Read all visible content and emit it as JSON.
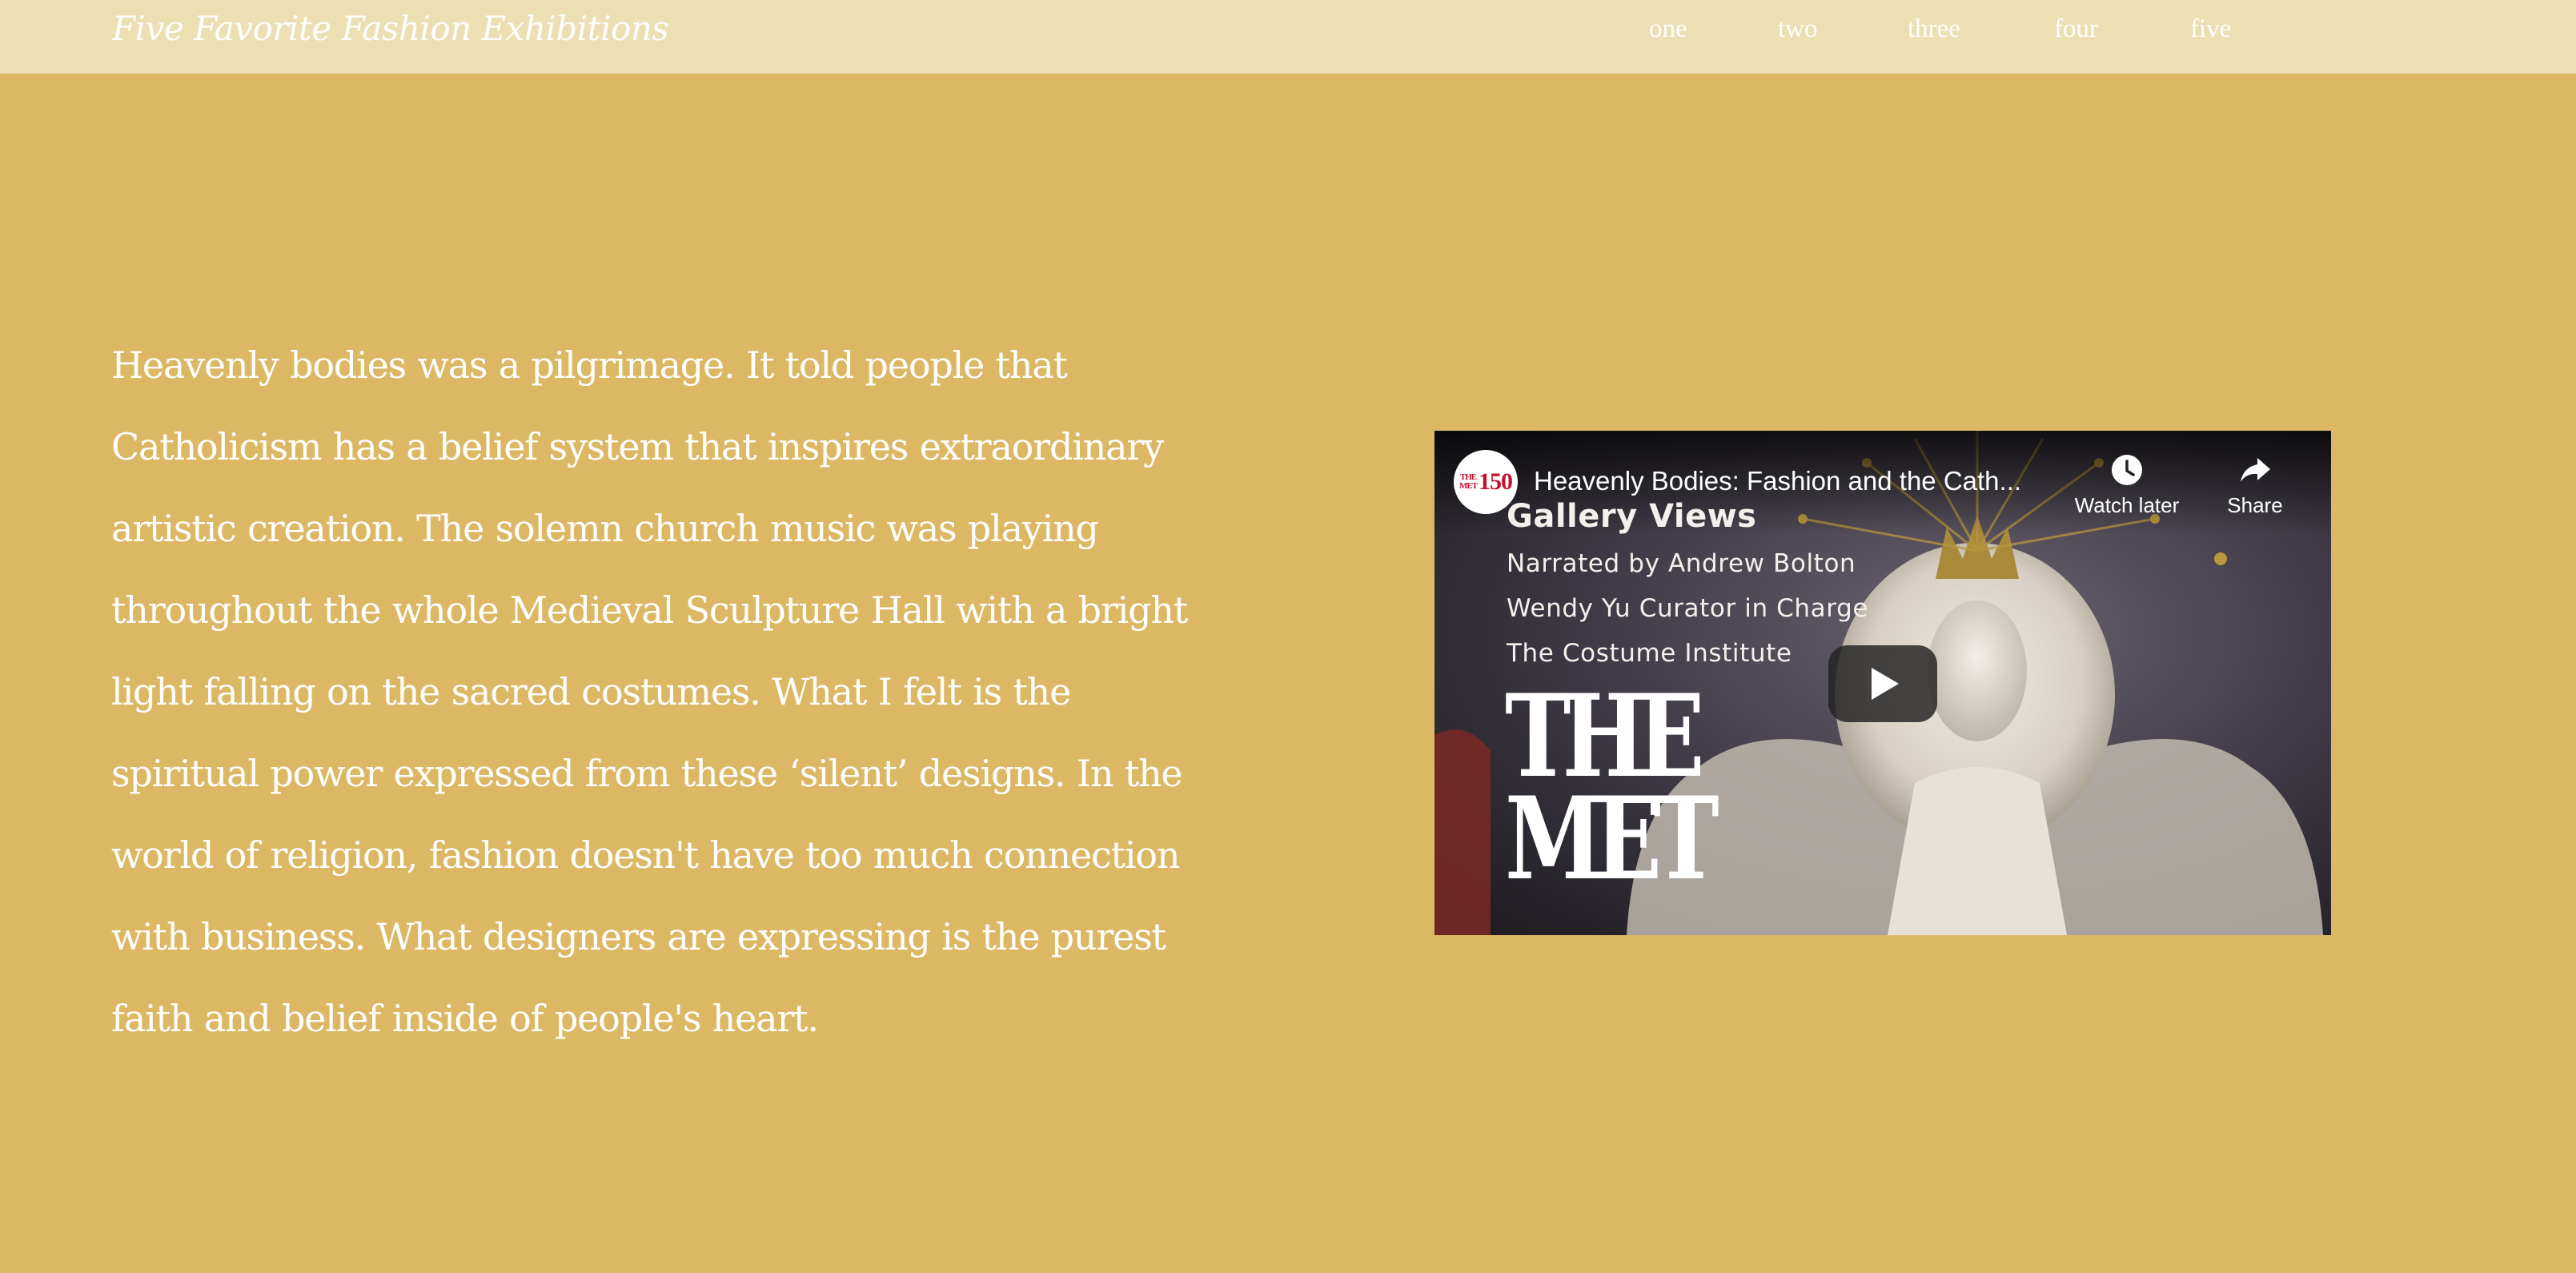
{
  "header": {
    "site_title": "Five Favorite Fashion Exhibitions",
    "nav": [
      {
        "label": "one"
      },
      {
        "label": "two"
      },
      {
        "label": "three"
      },
      {
        "label": "four"
      },
      {
        "label": "five"
      }
    ]
  },
  "main": {
    "paragraph": "Heavenly bodies was a pilgrimage. It told people that Catholicism has a belief system that inspires extraordinary artistic creation. The solemn church music was playing throughout the whole Medieval Sculpture Hall with a bright light falling on the sacred costumes. What I felt is the spiritual power expressed from these ‘silent’ designs. In the world of religion, fashion doesn't have too much connection with business. What designers are expressing is the purest faith and belief inside of people's heart."
  },
  "video": {
    "title": "Heavenly Bodies: Fashion and the Cath...",
    "channel_logo_small": "THE MET",
    "channel_logo_number": "150",
    "watch_later_label": "Watch later",
    "share_label": "Share",
    "overlay_heading": "Gallery Views",
    "overlay_lines": [
      "Narrated by Andrew Bolton",
      "Wendy Yu Curator in Charge",
      "The Costume Institute"
    ],
    "logo_line1": "THE",
    "logo_line2": "MET",
    "icons": {
      "watch_later": "clock-icon",
      "share": "share-arrow-icon",
      "play": "play-icon"
    }
  },
  "colors": {
    "page_background": "#dcb865",
    "header_background": "#eedeb3",
    "text": "#ffffff",
    "channel_logo_red": "#c8102e"
  }
}
